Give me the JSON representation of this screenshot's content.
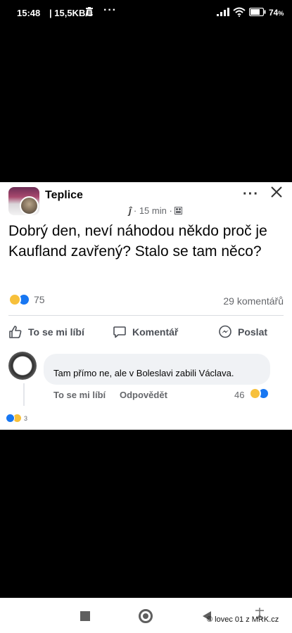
{
  "status_bar": {
    "time": "15:48",
    "network_speed": "| 15,5KB/s",
    "overflow": "···",
    "battery_percent": "74",
    "battery_suffix": "%"
  },
  "post": {
    "group_name": "Teplice",
    "moderator_glyph": "ĵ",
    "time_ago": "· 15 min ·",
    "text": "Dobrý den, neví náhodou někdo proč je Kaufland zavřený? Stalo se tam něco?",
    "reaction_count": "75",
    "comments_count": "29 komentářů",
    "more_label": "···"
  },
  "actions": {
    "like": "To se mi líbí",
    "comment": "Komentář",
    "share": "Poslat"
  },
  "comment": {
    "text": "Tam přímo ne, ale v Boleslavi zabili Václava.",
    "like": "To se mi líbí",
    "reply": "Odpovědět",
    "reaction_count": "46",
    "reply_reaction_count": "3"
  },
  "watermark": "© lovec 01 z MRK.cz",
  "colors": {
    "facebook_blue": "#1877f2",
    "haha_yellow": "#f7c03b",
    "secondary_text": "#65676b"
  }
}
